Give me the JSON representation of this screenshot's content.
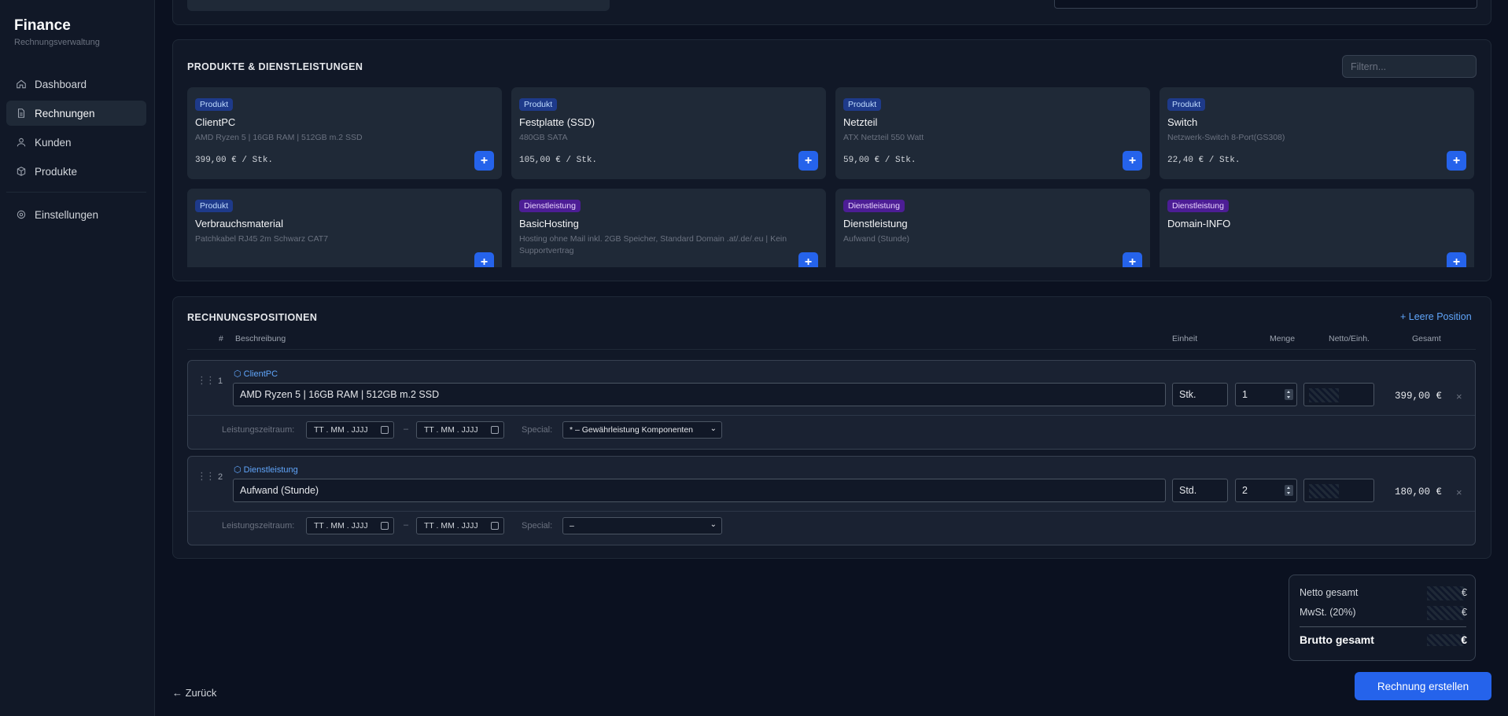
{
  "sidebar": {
    "brand": "Finance",
    "subtitle": "Rechnungsverwaltung",
    "items": [
      {
        "label": "Dashboard",
        "icon": "home-icon"
      },
      {
        "label": "Rechnungen",
        "icon": "document-icon"
      },
      {
        "label": "Kunden",
        "icon": "users-icon"
      },
      {
        "label": "Produkte",
        "icon": "box-icon"
      },
      {
        "label": "Einstellungen",
        "icon": "gear-icon"
      }
    ]
  },
  "products": {
    "title": "PRODUKTE & DIENSTLEISTUNGEN",
    "filter_placeholder": "Filtern...",
    "add_label": "+",
    "cards": [
      {
        "badge": "Produkt",
        "name": "ClientPC",
        "desc": "AMD Ryzen 5 | 16GB RAM | 512GB m.2 SSD",
        "price": "399,00 € / Stk."
      },
      {
        "badge": "Produkt",
        "name": "Festplatte (SSD)",
        "desc": "480GB SATA",
        "price": "105,00 € / Stk."
      },
      {
        "badge": "Produkt",
        "name": "Netzteil",
        "desc": "ATX Netzteil 550 Watt",
        "price": "59,00 € / Stk."
      },
      {
        "badge": "Produkt",
        "name": "Switch",
        "desc": "Netzwerk-Switch 8-Port(GS308)",
        "price": "22,40 € / Stk."
      },
      {
        "badge": "Produkt",
        "name": "Verbrauchsmaterial",
        "desc": "Patchkabel RJ45 2m Schwarz CAT7",
        "price": ""
      },
      {
        "badge": "Dienstleistung",
        "name": "BasicHosting",
        "desc": "Hosting ohne Mail inkl. 2GB Speicher, Standard Domain .at/.de/.eu | Kein Supportvertrag",
        "price": ""
      },
      {
        "badge": "Dienstleistung",
        "name": "Dienstleistung",
        "desc": "Aufwand (Stunde)",
        "price": ""
      },
      {
        "badge": "Dienstleistung",
        "name": "Domain-INFO",
        "desc": "",
        "price": ""
      }
    ]
  },
  "positions": {
    "title": "RECHNUNGSPOSITIONEN",
    "add_empty": "+ Leere Position",
    "headers": {
      "num": "#",
      "desc": "Beschreibung",
      "unit": "Einheit",
      "qty": "Menge",
      "net": "Netto/Einh.",
      "total": "Gesamt"
    },
    "period_label": "Leistungszeitraum:",
    "date_placeholder": "TT . MM . JJJJ",
    "dash": "–",
    "special_label": "Special:",
    "remove": "×",
    "rows": [
      {
        "num": "1",
        "type": "⬡ ClientPC",
        "desc": "AMD Ryzen 5 | 16GB RAM | 512GB m.2 SSD",
        "unit": "Stk.",
        "qty": "1",
        "total": "399,00 €",
        "special": "* – Gewährleistung Komponenten"
      },
      {
        "num": "2",
        "type": "⬡ Dienstleistung",
        "desc": "Aufwand (Stunde)",
        "unit": "Std.",
        "qty": "2",
        "total": "180,00 €",
        "special": "–"
      }
    ]
  },
  "totals": {
    "net_label": "Netto gesamt",
    "vat_label": "MwSt. (20%)",
    "gross_label": "Brutto gesamt",
    "currency": "€"
  },
  "footer": {
    "back": "← Zurück",
    "create": "Rechnung erstellen"
  }
}
